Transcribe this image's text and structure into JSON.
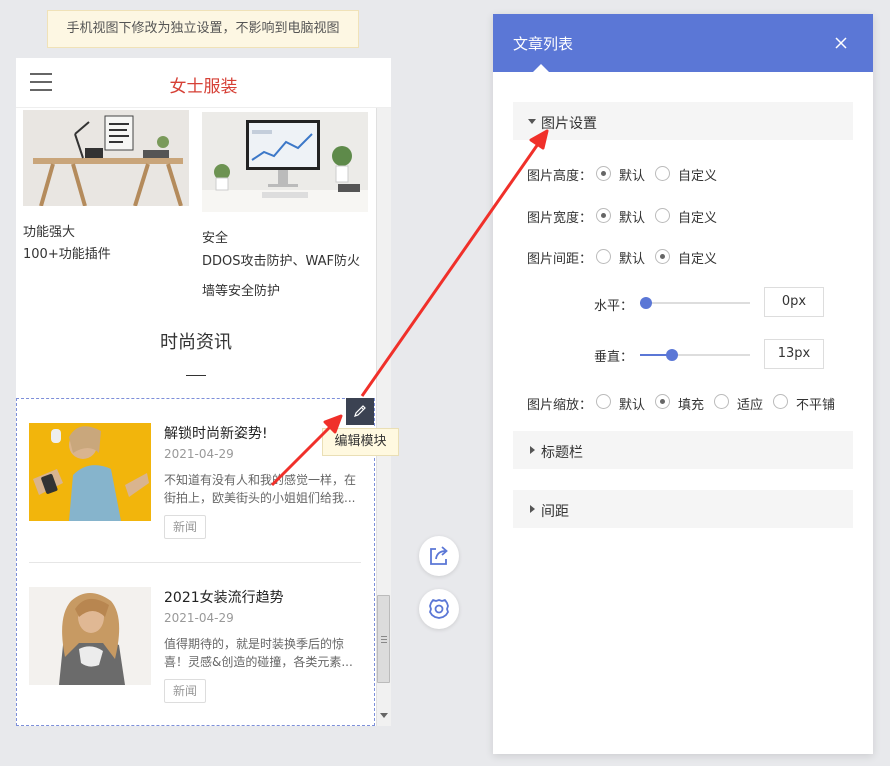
{
  "notice": "手机视图下修改为独立设置，不影响到电脑视图",
  "phone": {
    "title": "女士服装",
    "features": [
      {
        "title": "功能强大",
        "desc": "100+功能插件"
      },
      {
        "title": "安全",
        "desc": "DDOS攻击防护、WAF防火墙等安全防护"
      }
    ],
    "section_title": "时尚资讯",
    "articles": [
      {
        "title": "解锁时尚新姿势!",
        "date": "2021-04-29",
        "desc": "不知道有没有人和我的感觉一样，在街拍上，欧美街头的小姐姐们给我...",
        "tag": "新闻"
      },
      {
        "title": "2021女装流行趋势",
        "date": "2021-04-29",
        "desc": "值得期待的，就是时装换季后的惊喜！灵感&创造的碰撞，各类元素...",
        "tag": "新闻"
      }
    ],
    "edit_tip": "编辑模块"
  },
  "panel": {
    "title": "文章列表",
    "group_image": "图片设置",
    "group_titlebar": "标题栏",
    "group_spacing": "间距",
    "height": {
      "label": "图片高度：",
      "options": [
        "默认",
        "自定义"
      ],
      "selected": "默认"
    },
    "width": {
      "label": "图片宽度：",
      "options": [
        "默认",
        "自定义"
      ],
      "selected": "默认"
    },
    "gap": {
      "label": "图片间距：",
      "options": [
        "默认",
        "自定义"
      ],
      "selected": "自定义"
    },
    "horizontal": {
      "label": "水平：",
      "value": "0px",
      "level": 0
    },
    "vertical": {
      "label": "垂直：",
      "value": "13px",
      "level": 0.27
    },
    "scale": {
      "label": "图片缩放：",
      "options": [
        "默认",
        "填充",
        "适应",
        "不平铺"
      ],
      "selected": "填充"
    }
  },
  "colors": {
    "accent": "#5b77d6",
    "brand_red": "#d64036",
    "arrow": "#f0302a"
  },
  "icons": {
    "edit": "pencil-icon",
    "share": "share-icon",
    "settings": "gear-icon",
    "close": "close-icon",
    "menu": "menu-icon"
  }
}
